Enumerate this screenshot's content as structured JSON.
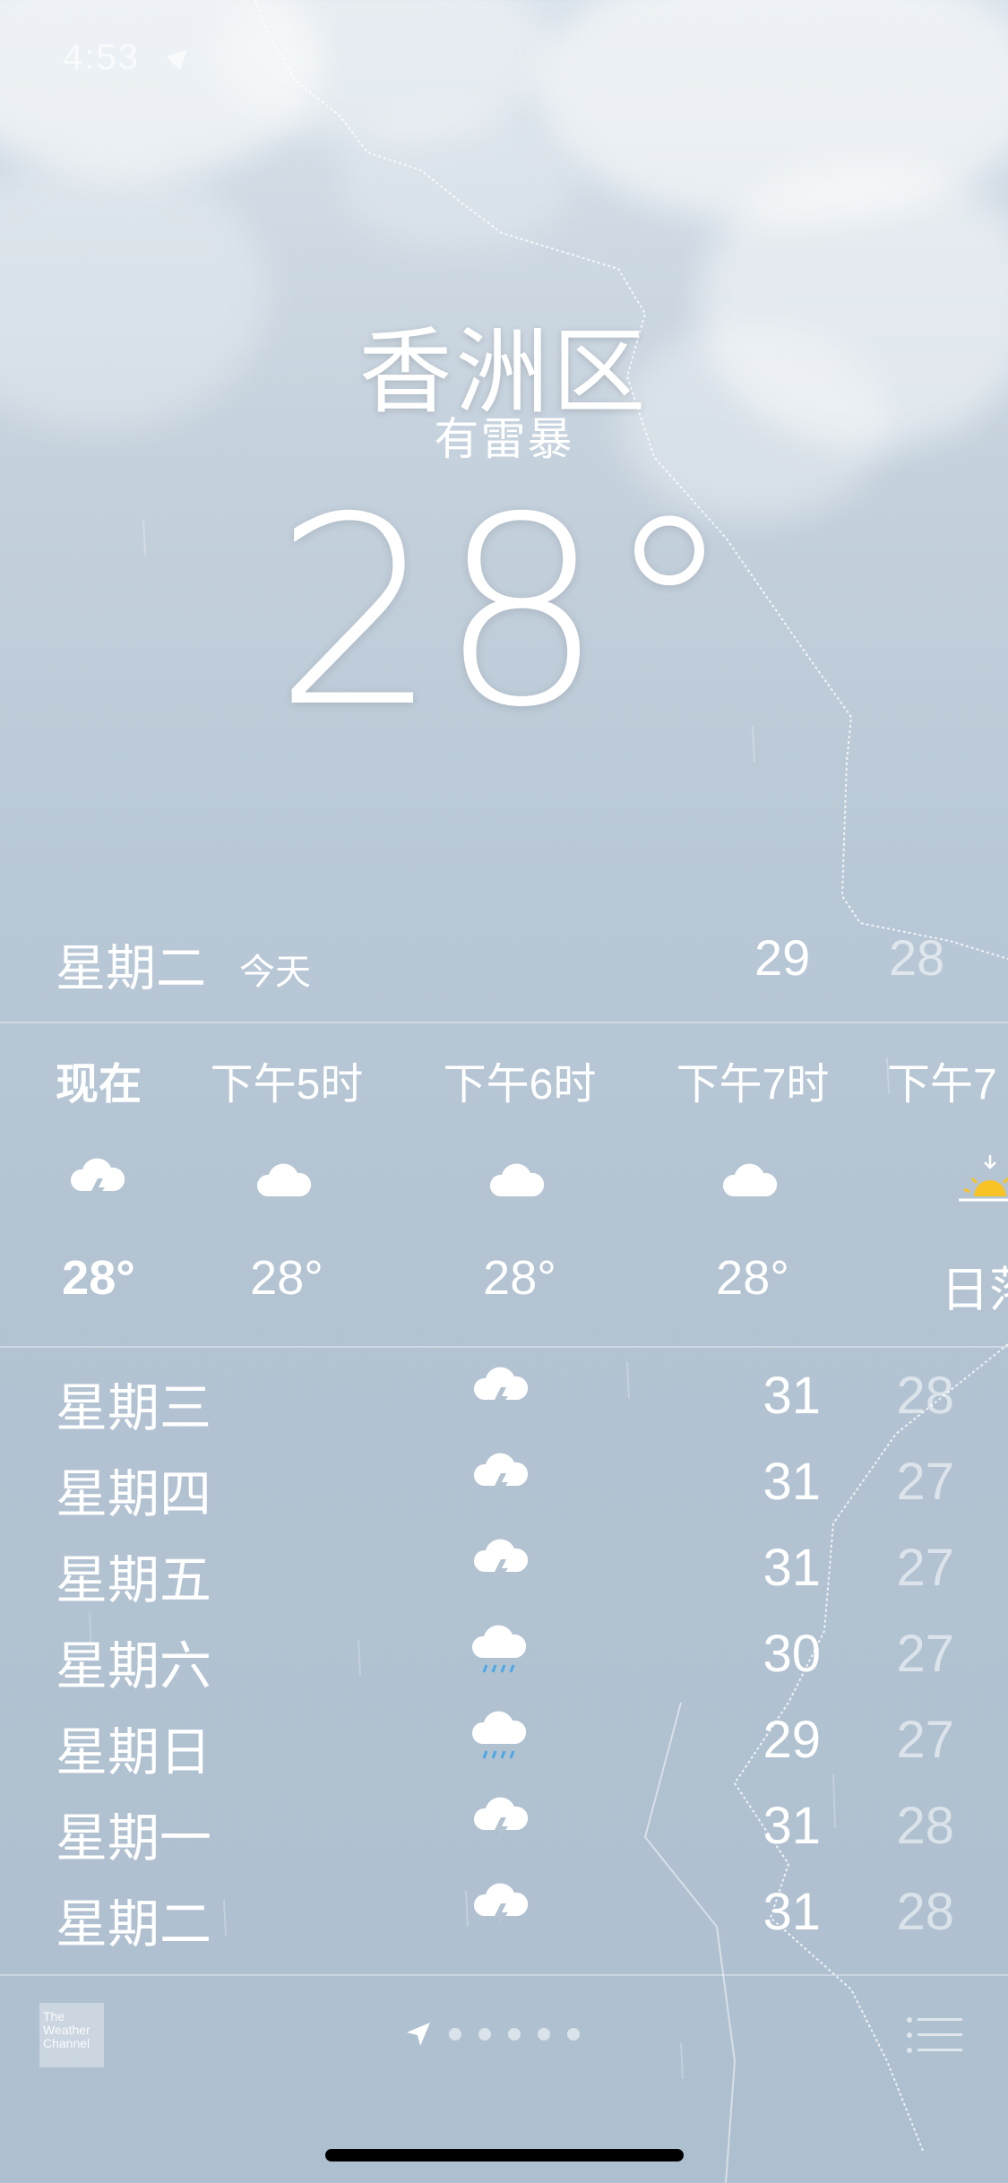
{
  "status_bar": {
    "time": "4:53"
  },
  "location": {
    "city": "香洲区",
    "condition": "有雷暴",
    "temperature": "28",
    "degree_symbol": "°"
  },
  "today": {
    "day": "星期二",
    "label": "今天",
    "high": "29",
    "low": "28"
  },
  "hourly": [
    {
      "time": "现在",
      "icon": "thunderstorm-icon",
      "temp": "28°",
      "bold": true
    },
    {
      "time": "下午5时",
      "icon": "cloud-icon",
      "temp": "28°"
    },
    {
      "time": "下午6时",
      "icon": "cloud-icon",
      "temp": "28°"
    },
    {
      "time": "下午7时",
      "icon": "cloud-icon",
      "temp": "28°"
    },
    {
      "time": "下午7",
      "icon": "sunset-icon",
      "temp": "日落"
    }
  ],
  "daily": [
    {
      "day": "星期三",
      "icon": "thunderstorm-icon",
      "high": "31",
      "low": "28"
    },
    {
      "day": "星期四",
      "icon": "thunderstorm-icon",
      "high": "31",
      "low": "27"
    },
    {
      "day": "星期五",
      "icon": "thunderstorm-icon",
      "high": "31",
      "low": "27"
    },
    {
      "day": "星期六",
      "icon": "rain-icon",
      "high": "30",
      "low": "27"
    },
    {
      "day": "星期日",
      "icon": "rain-icon",
      "high": "29",
      "low": "27"
    },
    {
      "day": "星期一",
      "icon": "thunderstorm-icon",
      "high": "31",
      "low": "28"
    },
    {
      "day": "星期二",
      "icon": "thunderstorm-icon",
      "high": "31",
      "low": "28"
    }
  ],
  "footer": {
    "logo_text": [
      "The",
      "Weather",
      "Channel"
    ],
    "page_dots": 5
  },
  "colors": {
    "rain_drop": "#4aa8e6",
    "sun": "#f7c325",
    "background_top": "#d9e2ea",
    "background_bottom": "#aebfcf"
  }
}
